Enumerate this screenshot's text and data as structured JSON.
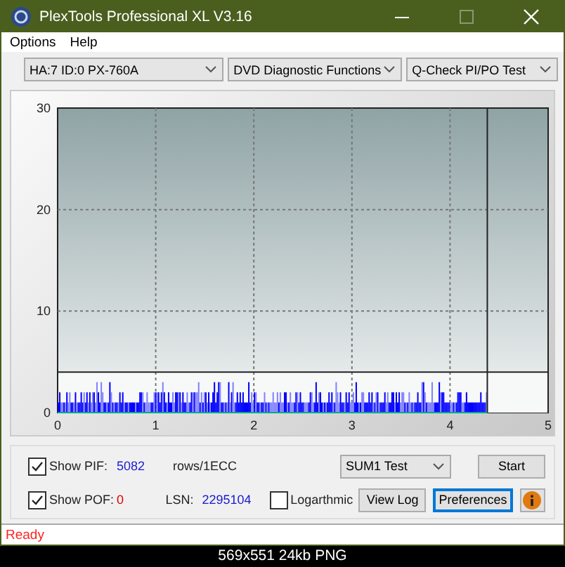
{
  "window": {
    "title": "PlexTools Professional XL V3.16"
  },
  "menu": [
    "Options",
    "Help"
  ],
  "selectors": [
    {
      "value": "HA:7 ID:0  PX-760A"
    },
    {
      "value": "DVD Diagnostic Functions"
    },
    {
      "value": "Q-Check PI/PO Test"
    }
  ],
  "chart": {
    "y_ticks": [
      "30",
      "20",
      "10",
      "0"
    ],
    "x_ticks": [
      "0",
      "1",
      "2",
      "3",
      "4",
      "5"
    ]
  },
  "controls": {
    "show_pif": {
      "label": "Show PIF:",
      "checked": true,
      "value": "5082"
    },
    "unit": "rows/1ECC",
    "show_pof": {
      "label": "Show POF:",
      "checked": true,
      "value": "0"
    },
    "lsn_label": "LSN:",
    "lsn_value": "2295104",
    "logarithmic": {
      "label": "Logarthmic",
      "checked": false
    },
    "test_select": "SUM1 Test",
    "buttons": [
      {
        "label": "Start",
        "focused": false
      },
      {
        "label": "View Log",
        "focused": false
      },
      {
        "label": "Preferences",
        "focused": true
      }
    ]
  },
  "status_bar": "Ready",
  "caption": "569x551 24kb PNG"
}
